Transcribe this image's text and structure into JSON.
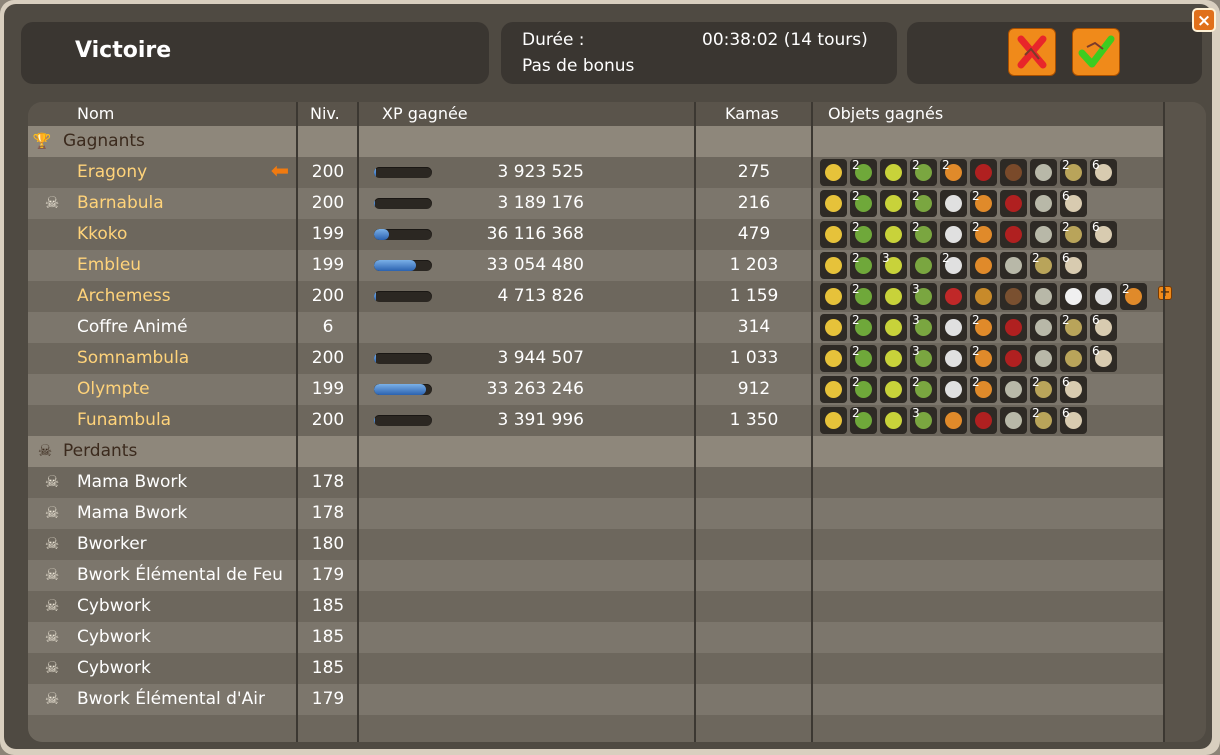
{
  "window": {
    "close_label": "×"
  },
  "header": {
    "title": "Victoire",
    "duration_label": "Durée :",
    "duration_value": "00:38:02 (14 tours)",
    "bonus": "Pas de bonus"
  },
  "columns": {
    "nom": "Nom",
    "niv": "Niv.",
    "xp": "XP gagnée",
    "kamas": "Kamas",
    "objets": "Objets gagnés"
  },
  "sections": {
    "winners": "Gagnants",
    "losers": "Perdants"
  },
  "colors": {
    "gold_name": "#ffd37a",
    "xp_bar_fill": "#2b62b0",
    "accent_button": "#f08a1a"
  },
  "winners": [
    {
      "name": "Eragony",
      "niv": "200",
      "xp": "3 923 525",
      "xp_fill": 0.03,
      "kamas": "275",
      "current_player": true,
      "items": [
        {
          "c": "#e6c23a"
        },
        {
          "c": "#6fa83a",
          "q": "2"
        },
        {
          "c": "#c8d23a"
        },
        {
          "c": "#7aa640",
          "q": "2"
        },
        {
          "c": "#e08a2a",
          "q": "2"
        },
        {
          "c": "#b02020"
        },
        {
          "c": "#7a4a2a"
        },
        {
          "c": "#b8b8a8"
        },
        {
          "c": "#b9a45a",
          "q": "2"
        },
        {
          "c": "#d8cbb0",
          "q": "6"
        }
      ]
    },
    {
      "name": "Barnabula",
      "niv": "200",
      "xp": "3 189 176",
      "xp_fill": 0.02,
      "kamas": "216",
      "skull": true,
      "items": [
        {
          "c": "#e6c23a"
        },
        {
          "c": "#6fa83a",
          "q": "2"
        },
        {
          "c": "#c8d23a"
        },
        {
          "c": "#7aa640",
          "q": "2"
        },
        {
          "c": "#e0e0e0"
        },
        {
          "c": "#e08a2a",
          "q": "2"
        },
        {
          "c": "#b02020"
        },
        {
          "c": "#b8b8a8"
        },
        {
          "c": "#d8cbb0",
          "q": "6"
        }
      ]
    },
    {
      "name": "Kkoko",
      "niv": "199",
      "xp": "36 116 368",
      "xp_fill": 0.25,
      "kamas": "479",
      "items": [
        {
          "c": "#e6c23a"
        },
        {
          "c": "#6fa83a",
          "q": "2"
        },
        {
          "c": "#c8d23a"
        },
        {
          "c": "#7aa640",
          "q": "2"
        },
        {
          "c": "#e0e0e0"
        },
        {
          "c": "#e08a2a",
          "q": "2"
        },
        {
          "c": "#b02020"
        },
        {
          "c": "#b8b8a8"
        },
        {
          "c": "#b9a45a",
          "q": "2"
        },
        {
          "c": "#d8cbb0",
          "q": "6"
        }
      ]
    },
    {
      "name": "Embleu",
      "niv": "199",
      "xp": "33 054 480",
      "xp_fill": 0.72,
      "kamas": "1 203",
      "items": [
        {
          "c": "#e6c23a"
        },
        {
          "c": "#6fa83a",
          "q": "2"
        },
        {
          "c": "#c8d23a",
          "q": "3"
        },
        {
          "c": "#7aa640"
        },
        {
          "c": "#e0e0e0",
          "q": "2"
        },
        {
          "c": "#e08a2a"
        },
        {
          "c": "#b8b8a8"
        },
        {
          "c": "#b9a45a",
          "q": "2"
        },
        {
          "c": "#d8cbb0",
          "q": "6"
        }
      ]
    },
    {
      "name": "Archemess",
      "niv": "200",
      "xp": "4 713 826",
      "xp_fill": 0.03,
      "kamas": "1 159",
      "more": "+",
      "items": [
        {
          "c": "#e6c23a"
        },
        {
          "c": "#6fa83a",
          "q": "2"
        },
        {
          "c": "#c8d23a"
        },
        {
          "c": "#7aa640",
          "q": "3"
        },
        {
          "c": "#c02828"
        },
        {
          "c": "#c88a2a"
        },
        {
          "c": "#7a5030"
        },
        {
          "c": "#b8b8a8"
        },
        {
          "c": "#f0f0f0"
        },
        {
          "c": "#e0e0e0"
        },
        {
          "c": "#e08a2a",
          "q": "2"
        }
      ]
    },
    {
      "name": "Coffre Animé",
      "niv": "6",
      "xp": "",
      "kamas": "314",
      "plain": true,
      "items": [
        {
          "c": "#e6c23a"
        },
        {
          "c": "#6fa83a",
          "q": "2"
        },
        {
          "c": "#c8d23a"
        },
        {
          "c": "#7aa640",
          "q": "3"
        },
        {
          "c": "#e0e0e0"
        },
        {
          "c": "#e08a2a",
          "q": "2"
        },
        {
          "c": "#b02020"
        },
        {
          "c": "#b8b8a8"
        },
        {
          "c": "#b9a45a",
          "q": "2"
        },
        {
          "c": "#d8cbb0",
          "q": "6"
        }
      ]
    },
    {
      "name": "Somnambula",
      "niv": "200",
      "xp": "3 944 507",
      "xp_fill": 0.03,
      "kamas": "1 033",
      "items": [
        {
          "c": "#e6c23a"
        },
        {
          "c": "#6fa83a",
          "q": "2"
        },
        {
          "c": "#c8d23a"
        },
        {
          "c": "#7aa640",
          "q": "3"
        },
        {
          "c": "#e0e0e0"
        },
        {
          "c": "#e08a2a",
          "q": "2"
        },
        {
          "c": "#b02020"
        },
        {
          "c": "#b8b8a8"
        },
        {
          "c": "#b9a45a"
        },
        {
          "c": "#d8cbb0",
          "q": "6"
        }
      ]
    },
    {
      "name": "Olympte",
      "niv": "199",
      "xp": "33 263 246",
      "xp_fill": 0.9,
      "kamas": "912",
      "items": [
        {
          "c": "#e6c23a"
        },
        {
          "c": "#6fa83a",
          "q": "2"
        },
        {
          "c": "#c8d23a"
        },
        {
          "c": "#7aa640",
          "q": "2"
        },
        {
          "c": "#e0e0e0"
        },
        {
          "c": "#e08a2a",
          "q": "2"
        },
        {
          "c": "#b8b8a8"
        },
        {
          "c": "#b9a45a",
          "q": "2"
        },
        {
          "c": "#d8cbb0",
          "q": "6"
        }
      ]
    },
    {
      "name": "Funambula",
      "niv": "200",
      "xp": "3 391 996",
      "xp_fill": 0.02,
      "kamas": "1 350",
      "items": [
        {
          "c": "#e6c23a"
        },
        {
          "c": "#6fa83a",
          "q": "2"
        },
        {
          "c": "#c8d23a"
        },
        {
          "c": "#7aa640",
          "q": "3"
        },
        {
          "c": "#e08a2a"
        },
        {
          "c": "#b02020"
        },
        {
          "c": "#b8b8a8"
        },
        {
          "c": "#b9a45a",
          "q": "2"
        },
        {
          "c": "#d8cbb0",
          "q": "6"
        }
      ]
    }
  ],
  "losers": [
    {
      "name": "Mama Bwork",
      "niv": "178"
    },
    {
      "name": "Mama Bwork",
      "niv": "178"
    },
    {
      "name": "Bworker",
      "niv": "180"
    },
    {
      "name": "Bwork Élémental de Feu",
      "niv": "179"
    },
    {
      "name": "Cybwork",
      "niv": "185"
    },
    {
      "name": "Cybwork",
      "niv": "185"
    },
    {
      "name": "Cybwork",
      "niv": "185"
    },
    {
      "name": "Bwork Élémental d'Air",
      "niv": "179"
    }
  ]
}
